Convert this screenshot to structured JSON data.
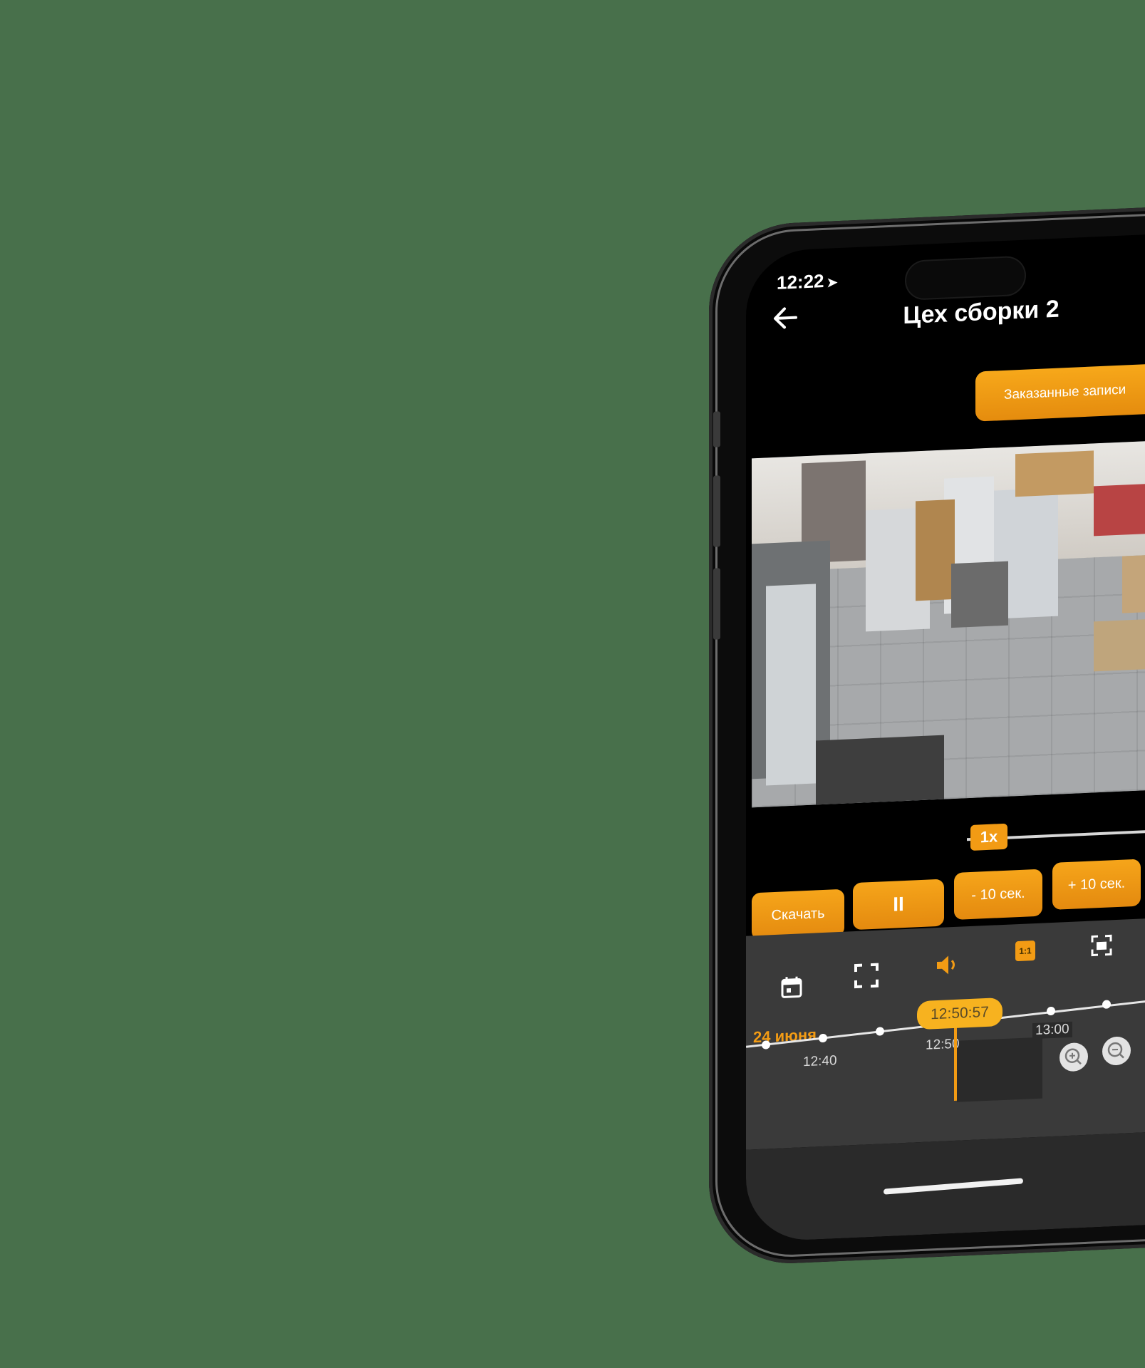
{
  "status_bar": {
    "time": "12:22"
  },
  "header": {
    "title": "Цех сборки 2"
  },
  "orders_button": {
    "label": "Заказанные записи"
  },
  "speed": {
    "label": "1x"
  },
  "actions": {
    "download": "Скачать",
    "pause": "II",
    "minus10": "- 10 сек.",
    "plus10": "+ 10 сек."
  },
  "toolbar": {
    "icons": [
      "calendar-icon",
      "fullscreen-icon",
      "speaker-icon",
      "aspect-1to1-icon",
      "screenshot-icon"
    ],
    "aspect_label": "1:1"
  },
  "timeline": {
    "date": "24 июня",
    "current_time": "12:50:57",
    "ticks": [
      "12:40",
      "12:50",
      "13:00"
    ]
  },
  "colors": {
    "accent": "#f29b14",
    "background": "#48704b",
    "panel": "#3a3a3a"
  }
}
